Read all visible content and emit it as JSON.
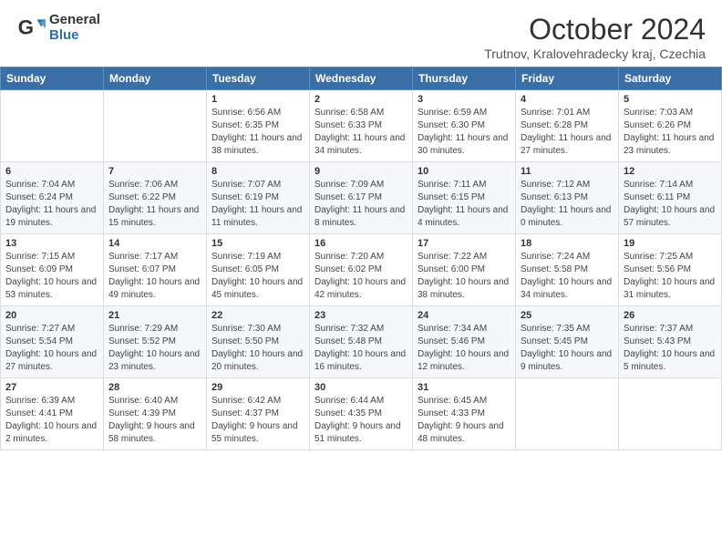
{
  "header": {
    "logo_general": "General",
    "logo_blue": "Blue",
    "title": "October 2024",
    "location": "Trutnov, Kralovehradecky kraj, Czechia"
  },
  "weekdays": [
    "Sunday",
    "Monday",
    "Tuesday",
    "Wednesday",
    "Thursday",
    "Friday",
    "Saturday"
  ],
  "weeks": [
    [
      {
        "num": "",
        "info": ""
      },
      {
        "num": "",
        "info": ""
      },
      {
        "num": "1",
        "info": "Sunrise: 6:56 AM\nSunset: 6:35 PM\nDaylight: 11 hours and 38 minutes."
      },
      {
        "num": "2",
        "info": "Sunrise: 6:58 AM\nSunset: 6:33 PM\nDaylight: 11 hours and 34 minutes."
      },
      {
        "num": "3",
        "info": "Sunrise: 6:59 AM\nSunset: 6:30 PM\nDaylight: 11 hours and 30 minutes."
      },
      {
        "num": "4",
        "info": "Sunrise: 7:01 AM\nSunset: 6:28 PM\nDaylight: 11 hours and 27 minutes."
      },
      {
        "num": "5",
        "info": "Sunrise: 7:03 AM\nSunset: 6:26 PM\nDaylight: 11 hours and 23 minutes."
      }
    ],
    [
      {
        "num": "6",
        "info": "Sunrise: 7:04 AM\nSunset: 6:24 PM\nDaylight: 11 hours and 19 minutes."
      },
      {
        "num": "7",
        "info": "Sunrise: 7:06 AM\nSunset: 6:22 PM\nDaylight: 11 hours and 15 minutes."
      },
      {
        "num": "8",
        "info": "Sunrise: 7:07 AM\nSunset: 6:19 PM\nDaylight: 11 hours and 11 minutes."
      },
      {
        "num": "9",
        "info": "Sunrise: 7:09 AM\nSunset: 6:17 PM\nDaylight: 11 hours and 8 minutes."
      },
      {
        "num": "10",
        "info": "Sunrise: 7:11 AM\nSunset: 6:15 PM\nDaylight: 11 hours and 4 minutes."
      },
      {
        "num": "11",
        "info": "Sunrise: 7:12 AM\nSunset: 6:13 PM\nDaylight: 11 hours and 0 minutes."
      },
      {
        "num": "12",
        "info": "Sunrise: 7:14 AM\nSunset: 6:11 PM\nDaylight: 10 hours and 57 minutes."
      }
    ],
    [
      {
        "num": "13",
        "info": "Sunrise: 7:15 AM\nSunset: 6:09 PM\nDaylight: 10 hours and 53 minutes."
      },
      {
        "num": "14",
        "info": "Sunrise: 7:17 AM\nSunset: 6:07 PM\nDaylight: 10 hours and 49 minutes."
      },
      {
        "num": "15",
        "info": "Sunrise: 7:19 AM\nSunset: 6:05 PM\nDaylight: 10 hours and 45 minutes."
      },
      {
        "num": "16",
        "info": "Sunrise: 7:20 AM\nSunset: 6:02 PM\nDaylight: 10 hours and 42 minutes."
      },
      {
        "num": "17",
        "info": "Sunrise: 7:22 AM\nSunset: 6:00 PM\nDaylight: 10 hours and 38 minutes."
      },
      {
        "num": "18",
        "info": "Sunrise: 7:24 AM\nSunset: 5:58 PM\nDaylight: 10 hours and 34 minutes."
      },
      {
        "num": "19",
        "info": "Sunrise: 7:25 AM\nSunset: 5:56 PM\nDaylight: 10 hours and 31 minutes."
      }
    ],
    [
      {
        "num": "20",
        "info": "Sunrise: 7:27 AM\nSunset: 5:54 PM\nDaylight: 10 hours and 27 minutes."
      },
      {
        "num": "21",
        "info": "Sunrise: 7:29 AM\nSunset: 5:52 PM\nDaylight: 10 hours and 23 minutes."
      },
      {
        "num": "22",
        "info": "Sunrise: 7:30 AM\nSunset: 5:50 PM\nDaylight: 10 hours and 20 minutes."
      },
      {
        "num": "23",
        "info": "Sunrise: 7:32 AM\nSunset: 5:48 PM\nDaylight: 10 hours and 16 minutes."
      },
      {
        "num": "24",
        "info": "Sunrise: 7:34 AM\nSunset: 5:46 PM\nDaylight: 10 hours and 12 minutes."
      },
      {
        "num": "25",
        "info": "Sunrise: 7:35 AM\nSunset: 5:45 PM\nDaylight: 10 hours and 9 minutes."
      },
      {
        "num": "26",
        "info": "Sunrise: 7:37 AM\nSunset: 5:43 PM\nDaylight: 10 hours and 5 minutes."
      }
    ],
    [
      {
        "num": "27",
        "info": "Sunrise: 6:39 AM\nSunset: 4:41 PM\nDaylight: 10 hours and 2 minutes."
      },
      {
        "num": "28",
        "info": "Sunrise: 6:40 AM\nSunset: 4:39 PM\nDaylight: 9 hours and 58 minutes."
      },
      {
        "num": "29",
        "info": "Sunrise: 6:42 AM\nSunset: 4:37 PM\nDaylight: 9 hours and 55 minutes."
      },
      {
        "num": "30",
        "info": "Sunrise: 6:44 AM\nSunset: 4:35 PM\nDaylight: 9 hours and 51 minutes."
      },
      {
        "num": "31",
        "info": "Sunrise: 6:45 AM\nSunset: 4:33 PM\nDaylight: 9 hours and 48 minutes."
      },
      {
        "num": "",
        "info": ""
      },
      {
        "num": "",
        "info": ""
      }
    ]
  ]
}
